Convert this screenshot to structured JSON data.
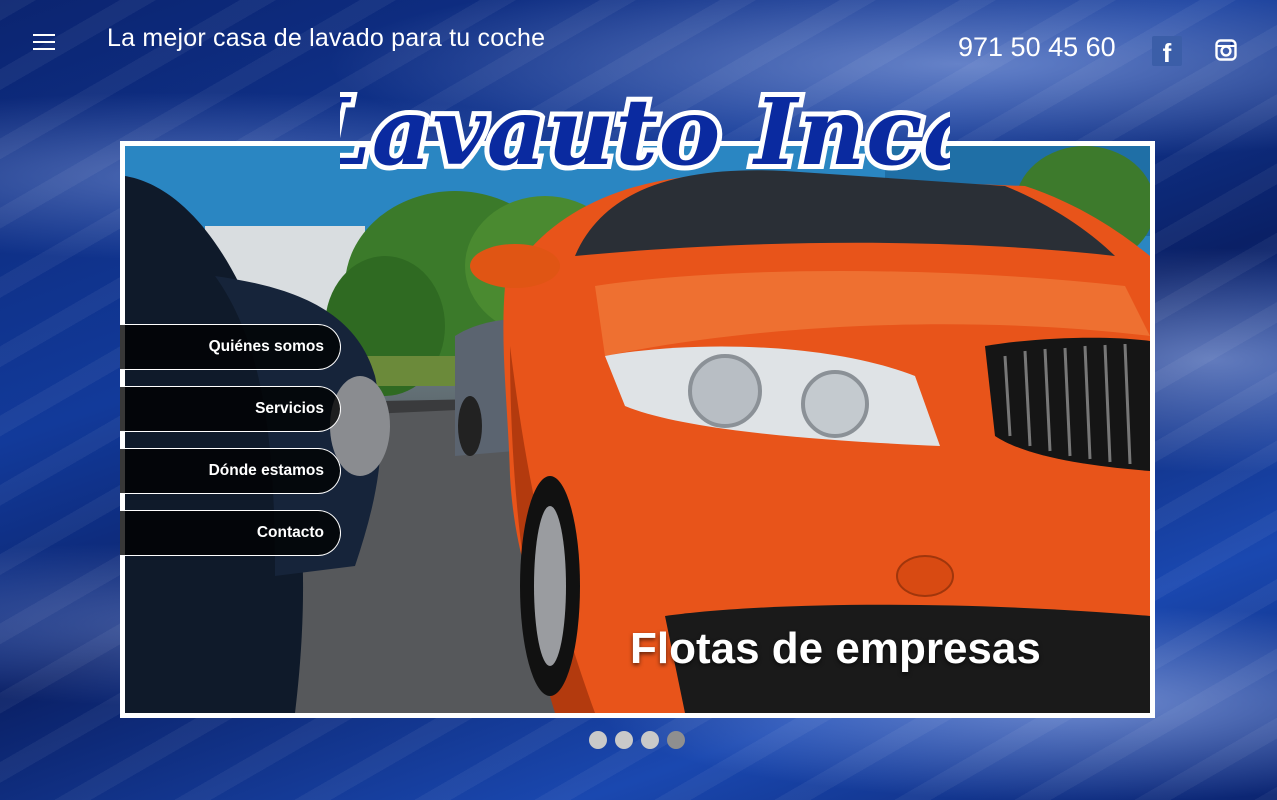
{
  "header": {
    "menu_icon": "hamburger-menu-icon",
    "tagline": "La mejor casa de lavado para tu coche",
    "phone": "971 50 45 60",
    "social": [
      {
        "name": "facebook",
        "icon": "facebook-icon",
        "glyph": "f"
      },
      {
        "name": "instagram",
        "icon": "instagram-icon"
      }
    ]
  },
  "logo": {
    "text": "Lavauto Inca"
  },
  "slider": {
    "caption": "Flotas de empresas",
    "total_slides": 4,
    "active_slide": 4
  },
  "nav": {
    "items": [
      {
        "label": "Quiénes somos"
      },
      {
        "label": "Servicios"
      },
      {
        "label": "Dónde estamos"
      },
      {
        "label": "Contacto"
      }
    ]
  },
  "colors": {
    "background": "#0d2a78",
    "logo_blue": "#0a2aa0",
    "car_orange": "#e8541a",
    "facebook": "#3b5ea8"
  }
}
